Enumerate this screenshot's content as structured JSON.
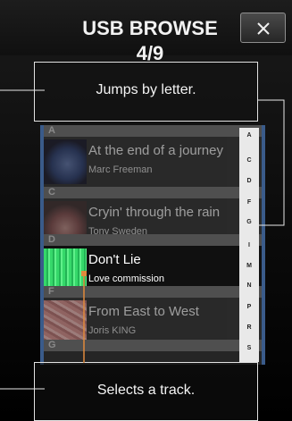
{
  "header": {
    "title": "USB BROWSE 4/9",
    "close_icon": "close-icon"
  },
  "list": {
    "sections": [
      {
        "letter": "A"
      },
      {
        "letter": "C"
      },
      {
        "letter": "D"
      },
      {
        "letter": "F"
      },
      {
        "letter": "G"
      }
    ],
    "tracks": [
      {
        "title": "At the end of a journey",
        "artist": "Marc Freeman",
        "active": false
      },
      {
        "title": "Cryin' through the rain",
        "artist": "Tony Sweden",
        "active": false
      },
      {
        "title": "Don't Lie",
        "artist": "Love commission",
        "active": true
      },
      {
        "title": "From East to West",
        "artist": "Joris KING",
        "active": false
      }
    ]
  },
  "index_letters": [
    "A",
    "C",
    "D",
    "F",
    "G",
    "I",
    "M",
    "N",
    "P",
    "R",
    "S"
  ],
  "callouts": {
    "top": "Jumps by letter.",
    "bottom": "Selects a track."
  }
}
